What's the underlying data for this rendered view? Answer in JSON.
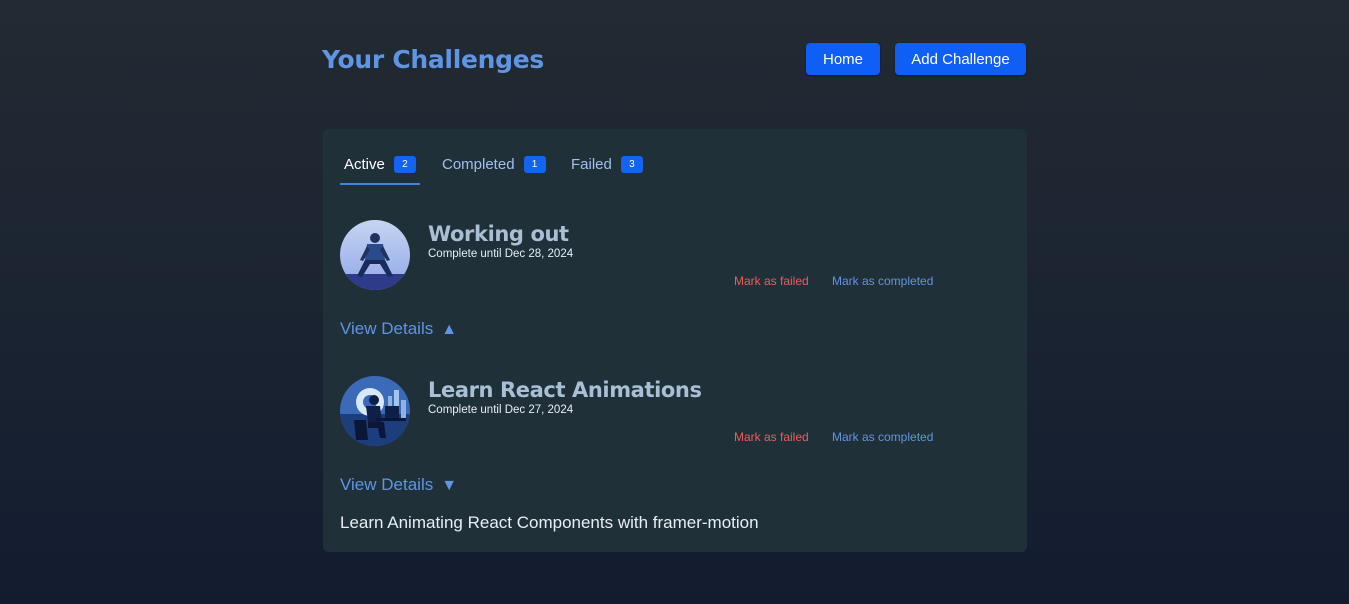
{
  "header": {
    "title": "Your Challenges",
    "home_label": "Home",
    "add_label": "Add Challenge"
  },
  "tabs": [
    {
      "label": "Active",
      "count": "2"
    },
    {
      "label": "Completed",
      "count": "1"
    },
    {
      "label": "Failed",
      "count": "3"
    }
  ],
  "challenges": [
    {
      "title": "Working out",
      "deadline": "Complete until Dec 28, 2024",
      "fail_label": "Mark as failed",
      "complete_label": "Mark as completed",
      "details_label": "View Details",
      "details_arrow": "▲",
      "image_icon": "workout-image"
    },
    {
      "title": "Learn React Animations",
      "deadline": "Complete until Dec 27, 2024",
      "fail_label": "Mark as failed",
      "complete_label": "Mark as completed",
      "details_label": "View Details",
      "details_arrow": "▼",
      "image_icon": "coding-image",
      "description": "Learn Animating React Components with framer-motion"
    }
  ],
  "colors": {
    "accent": "#0f5ef5",
    "title": "#5f95e3",
    "danger": "#f25a5a",
    "panel": "#203039"
  }
}
